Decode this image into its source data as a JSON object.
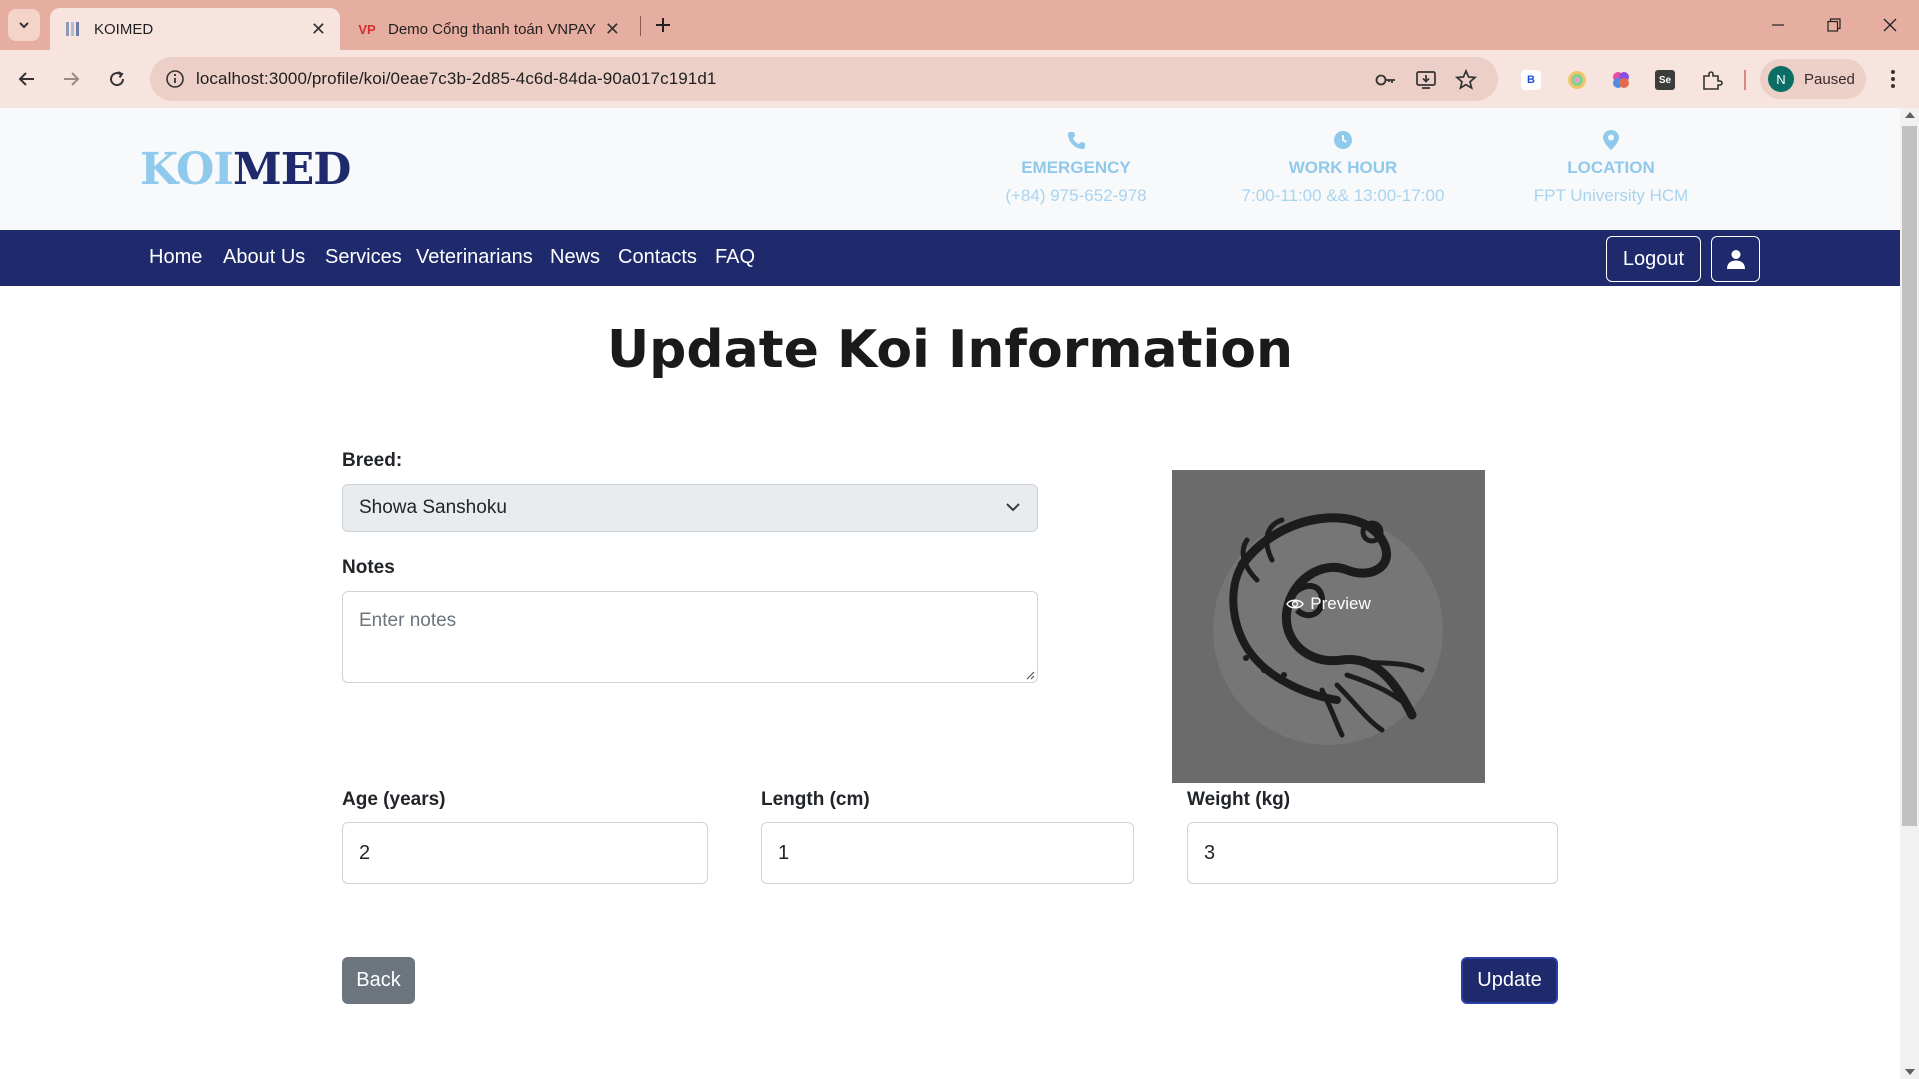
{
  "browser": {
    "tabs": [
      {
        "title": "KOIMED",
        "active": true
      },
      {
        "title": "Demo Cổng thanh toán VNPAY",
        "favicon_text": "VP",
        "active": false
      }
    ],
    "url": "localhost:3000/profile/koi/0eae7c3b-2d85-4c6d-84da-90a017c191d1",
    "profile_initial": "N",
    "profile_status": "Paused",
    "extensions": [
      "b-extension",
      "color-extension",
      "brain-extension",
      "selenium-extension",
      "puzzle-extension"
    ],
    "ext_label_b": "B",
    "ext_label_se": "Se"
  },
  "site": {
    "logo_part1": "KOI",
    "logo_part2": "MED",
    "info": [
      {
        "icon": "phone-icon",
        "label": "EMERGENCY",
        "value": "(+84) 975-652-978"
      },
      {
        "icon": "clock-icon",
        "label": "WORK HOUR",
        "value": "7:00-11:00 && 13:00-17:00"
      },
      {
        "icon": "location-pin-icon",
        "label": "LOCATION",
        "value": "FPT University HCM"
      }
    ],
    "nav": [
      "Home",
      "About Us",
      "Services",
      "Veterinarians",
      "News",
      "Contacts",
      "FAQ"
    ],
    "logout_label": "Logout"
  },
  "form": {
    "title": "Update Koi Information",
    "breed_label": "Breed:",
    "breed_value": "Showa Sanshoku",
    "notes_label": "Notes",
    "notes_placeholder": "Enter notes",
    "preview_label": "Preview",
    "age_label": "Age (years)",
    "age_value": "2",
    "length_label": "Length (cm)",
    "length_value": "1",
    "weight_label": "Weight (kg)",
    "weight_value": "3",
    "back_label": "Back",
    "update_label": "Update"
  },
  "colors": {
    "brand_navy": "#1e2a6b",
    "brand_light_blue": "#8fc9ec",
    "tabbar": "#e6aea0",
    "back_button": "#6c757d"
  }
}
